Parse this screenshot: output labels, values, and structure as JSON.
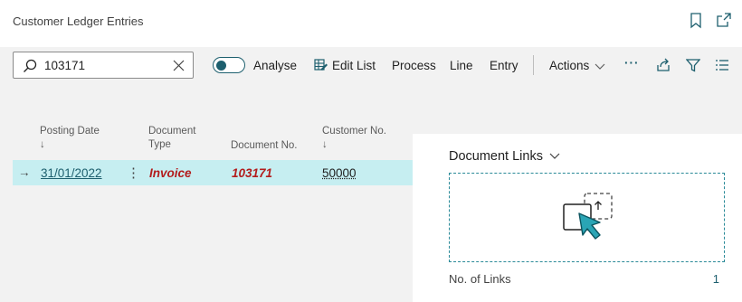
{
  "header": {
    "title": "Customer Ledger Entries"
  },
  "actionbar": {
    "search_value": "103171",
    "analyse_label": "Analyse",
    "edit_list_label": "Edit List",
    "process_label": "Process",
    "line_label": "Line",
    "entry_label": "Entry",
    "actions_label": "Actions",
    "more_label": "···"
  },
  "list": {
    "columns": {
      "posting_date": [
        "Posting Date",
        "↓"
      ],
      "document_type": [
        "Document",
        "Type"
      ],
      "document_no": "Document No.",
      "customer_no": [
        "Customer No.",
        "↓"
      ]
    },
    "rows": [
      {
        "row_arrow": "→",
        "row_menu": "⋮",
        "posting_date": "31/01/2022",
        "document_type": "Invoice",
        "document_no": "103171",
        "customer_no": "50000"
      }
    ]
  },
  "factbox": {
    "title": "Document Links",
    "links_label": "No. of Links",
    "links_count": "1"
  },
  "colors": {
    "accent": "#1d5f6e",
    "selected_row": "#c6eef1",
    "invoice_red": "#b31d1d",
    "dropzone_border": "#2a8a98"
  }
}
